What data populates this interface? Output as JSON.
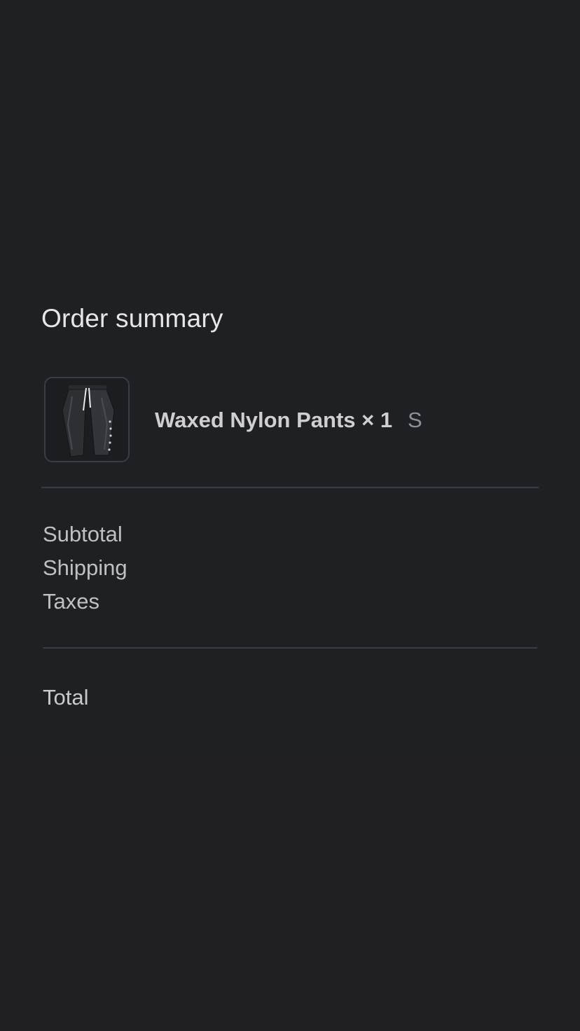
{
  "colors": {
    "page_background": "#1f1f21",
    "panel_background": "#1f2024",
    "divider": "#3a3b40",
    "title_text": "#e6e6e8",
    "item_text": "#cfcfd2",
    "muted_text": "#8e8f94"
  },
  "order_summary": {
    "title": "Order summary",
    "items": [
      {
        "image_icon": "pants-product-image",
        "name_quantity": "Waxed Nylon Pants × 1",
        "size": "S"
      }
    ],
    "lines": {
      "subtotal_label": "Subtotal",
      "shipping_label": "Shipping",
      "taxes_label": "Taxes",
      "total_label": "Total"
    }
  }
}
